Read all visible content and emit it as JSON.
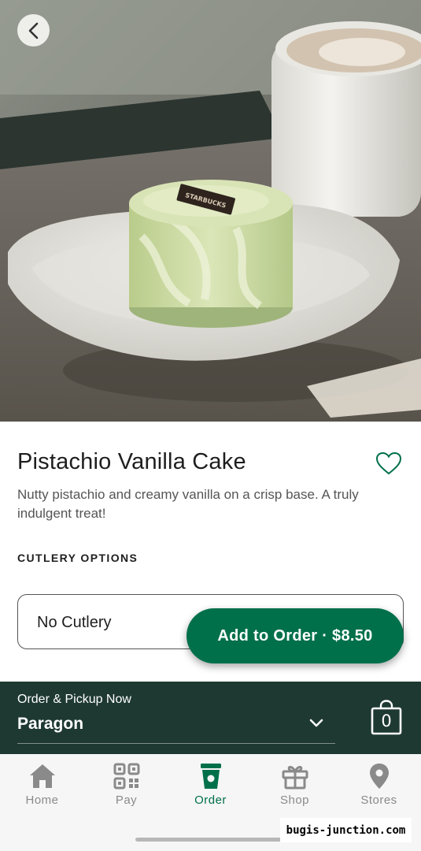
{
  "product": {
    "name": "Pistachio Vanilla Cake",
    "description": "Nutty pistachio and creamy vanilla on a crisp base. A truly indulgent treat!",
    "image_plaque_text": "STARBUCKS"
  },
  "cutlery": {
    "section_label": "CUTLERY OPTIONS",
    "selected": "No Cutlery"
  },
  "add_button": {
    "label": "Add to Order · $8.50"
  },
  "pickup": {
    "label": "Order & Pickup Now",
    "store": "Paragon",
    "bag_count": "0"
  },
  "nav": {
    "items": [
      {
        "label": "Home",
        "icon": "home-icon"
      },
      {
        "label": "Pay",
        "icon": "qr-code-icon"
      },
      {
        "label": "Order",
        "icon": "cup-icon",
        "active": true
      },
      {
        "label": "Shop",
        "icon": "gift-icon"
      },
      {
        "label": "Stores",
        "icon": "location-pin-icon"
      }
    ]
  },
  "watermark": "bugis-junction.com",
  "colors": {
    "brand_green": "#00704a",
    "house_green": "#1e3932",
    "inactive_nav": "#8a8a8a"
  }
}
